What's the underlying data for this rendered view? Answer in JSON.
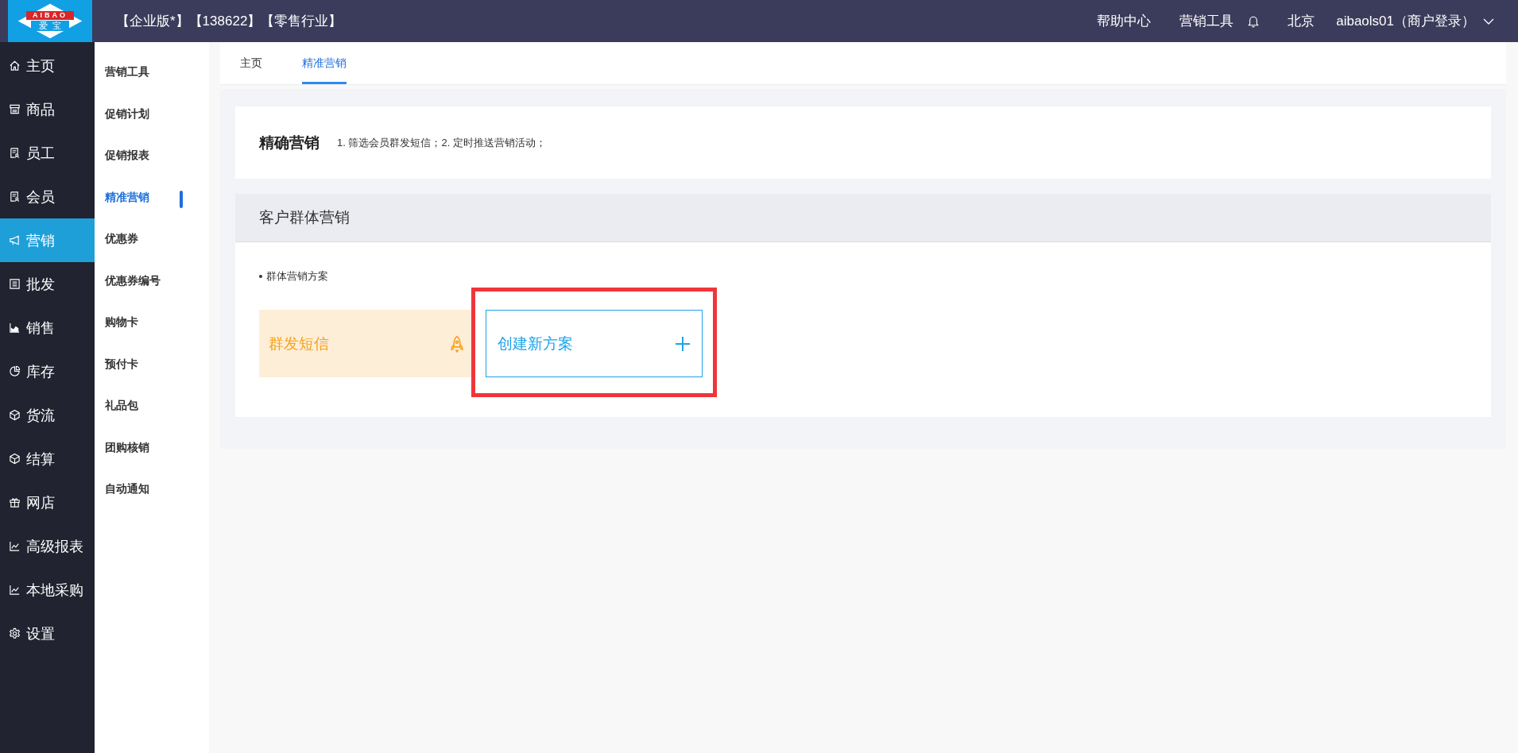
{
  "header": {
    "logo_top": "AIBAO",
    "logo_bottom": "爱  宝",
    "title": "【企业版*】【138622】【零售行业】",
    "links": [
      "帮助中心",
      "营销工具"
    ],
    "city": "北京",
    "user": "aibaols01（商户登录）"
  },
  "nav": [
    {
      "label": "主页",
      "selected": false
    },
    {
      "label": "商品",
      "selected": false
    },
    {
      "label": "员工",
      "selected": false
    },
    {
      "label": "会员",
      "selected": false
    },
    {
      "label": "营销",
      "selected": true
    },
    {
      "label": "批发",
      "selected": false
    },
    {
      "label": "销售",
      "selected": false
    },
    {
      "label": "库存",
      "selected": false
    },
    {
      "label": "货流",
      "selected": false
    },
    {
      "label": "结算",
      "selected": false
    },
    {
      "label": "网店",
      "selected": false
    },
    {
      "label": "高级报表",
      "selected": false
    },
    {
      "label": "本地采购",
      "selected": false
    },
    {
      "label": "设置",
      "selected": false
    }
  ],
  "submenu": [
    {
      "label": "营销工具",
      "selected": false
    },
    {
      "label": "促销计划",
      "selected": false
    },
    {
      "label": "促销报表",
      "selected": false
    },
    {
      "label": "精准营销",
      "selected": true
    },
    {
      "label": "优惠券",
      "selected": false
    },
    {
      "label": "优惠券编号",
      "selected": false
    },
    {
      "label": "购物卡",
      "selected": false
    },
    {
      "label": "预付卡",
      "selected": false
    },
    {
      "label": "礼品包",
      "selected": false
    },
    {
      "label": "团购核销",
      "selected": false
    },
    {
      "label": "自动通知",
      "selected": false
    }
  ],
  "tabs": [
    {
      "label": "主页",
      "selected": false
    },
    {
      "label": "精准营销",
      "selected": true
    }
  ],
  "intro": {
    "title": "精确营销",
    "description": "1. 筛选会员群发短信；2. 定时推送营销活动；"
  },
  "section": {
    "title": "客户群体营销",
    "subtitle": "群体营销方案",
    "cards": [
      {
        "kind": "plan",
        "label": "群发短信"
      },
      {
        "kind": "create",
        "label": "创建新方案"
      }
    ]
  }
}
